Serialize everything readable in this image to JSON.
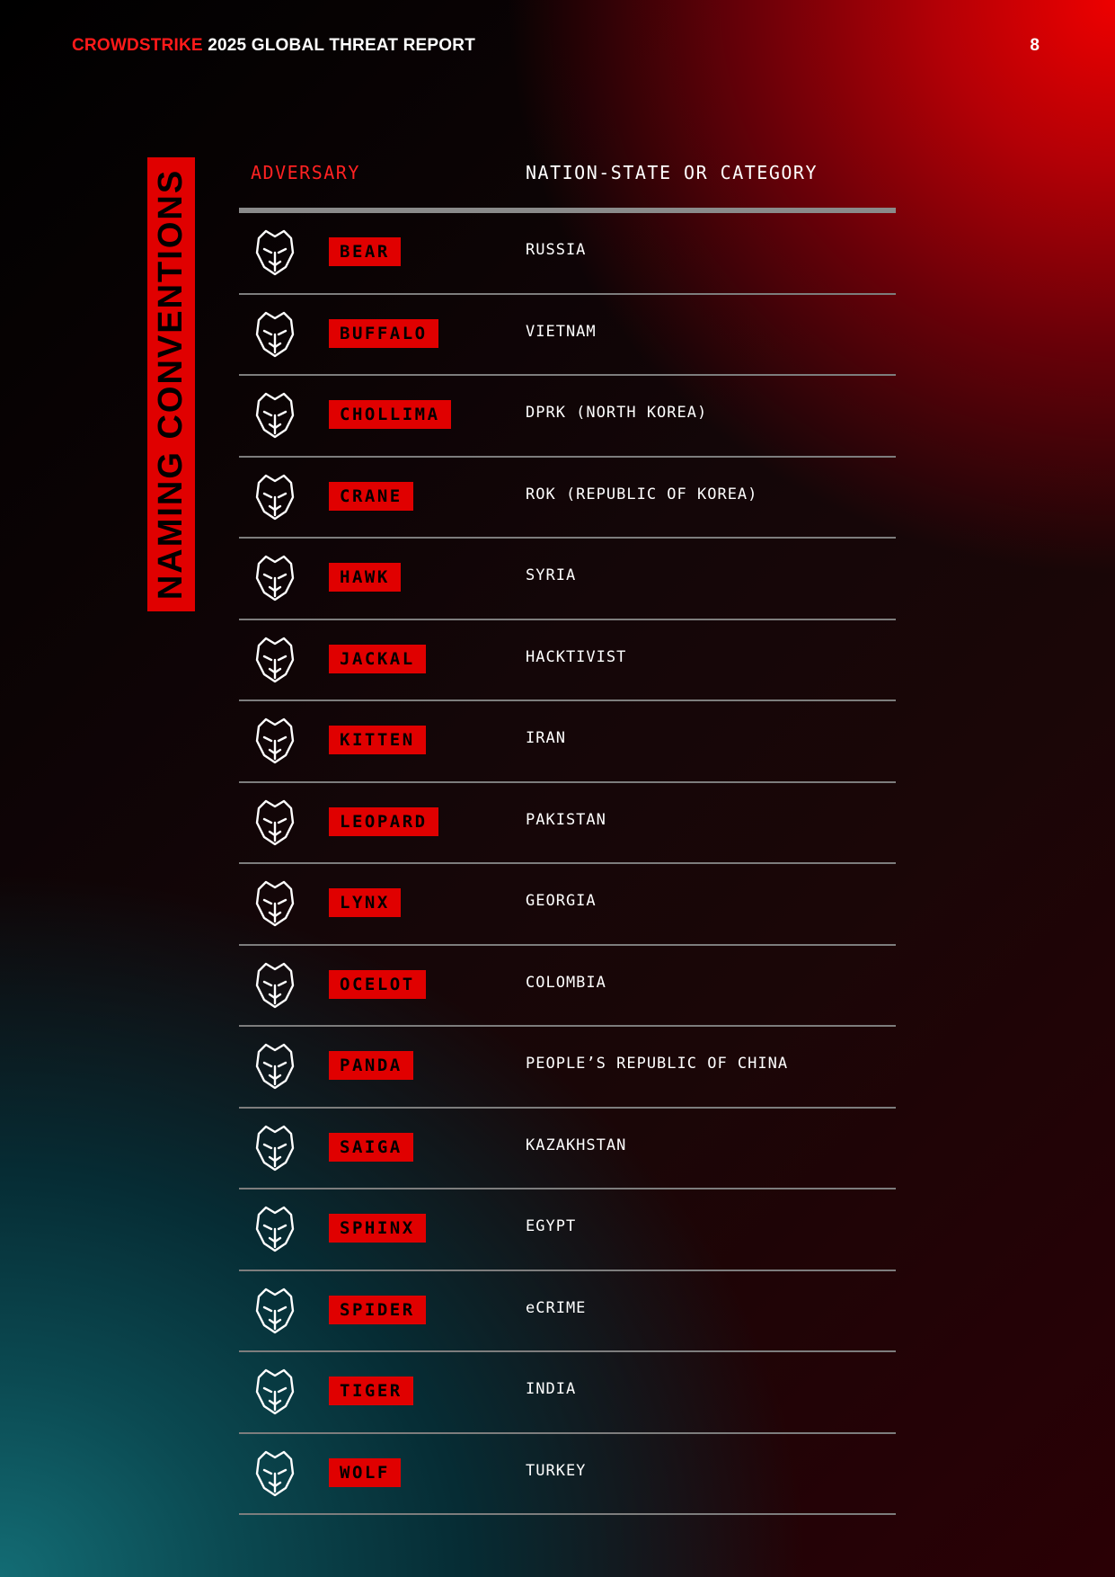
{
  "header": {
    "brand": "CROWDSTRIKE",
    "report_title": " 2025 GLOBAL THREAT REPORT",
    "page_number": "8"
  },
  "vertical_title": "NAMING CONVENTIONS",
  "columns": {
    "adversary": "ADVERSARY",
    "nation": "NATION-STATE OR CATEGORY"
  },
  "adversaries": [
    {
      "name": "BEAR",
      "nation": "RUSSIA",
      "icon": "bear-icon"
    },
    {
      "name": "BUFFALO",
      "nation": "VIETNAM",
      "icon": "buffalo-icon"
    },
    {
      "name": "CHOLLIMA",
      "nation": "DPRK (NORTH KOREA)",
      "icon": "chollima-icon"
    },
    {
      "name": "CRANE",
      "nation": "ROK (REPUBLIC OF KOREA)",
      "icon": "crane-icon"
    },
    {
      "name": "HAWK",
      "nation": "SYRIA",
      "icon": "hawk-icon"
    },
    {
      "name": "JACKAL",
      "nation": "HACKTIVIST",
      "icon": "jackal-icon"
    },
    {
      "name": "KITTEN",
      "nation": "IRAN",
      "icon": "kitten-icon"
    },
    {
      "name": "LEOPARD",
      "nation": "PAKISTAN",
      "icon": "leopard-icon"
    },
    {
      "name": "LYNX",
      "nation": "GEORGIA",
      "icon": "lynx-icon"
    },
    {
      "name": "OCELOT",
      "nation": "COLOMBIA",
      "icon": "ocelot-icon"
    },
    {
      "name": "PANDA",
      "nation": "PEOPLE’S REPUBLIC OF CHINA",
      "icon": "panda-icon"
    },
    {
      "name": "SAIGA",
      "nation": "KAZAKHSTAN",
      "icon": "saiga-icon"
    },
    {
      "name": "SPHINX",
      "nation": "EGYPT",
      "icon": "sphinx-icon"
    },
    {
      "name": "SPIDER",
      "nation": "eCRIME",
      "icon": "spider-icon"
    },
    {
      "name": "TIGER",
      "nation": "INDIA",
      "icon": "tiger-icon"
    },
    {
      "name": "WOLF",
      "nation": "TURKEY",
      "icon": "wolf-icon"
    }
  ],
  "colors": {
    "accent_red": "#e00000",
    "brand_red": "#ff1a1a",
    "rule_gray": "#7d7d7d"
  }
}
